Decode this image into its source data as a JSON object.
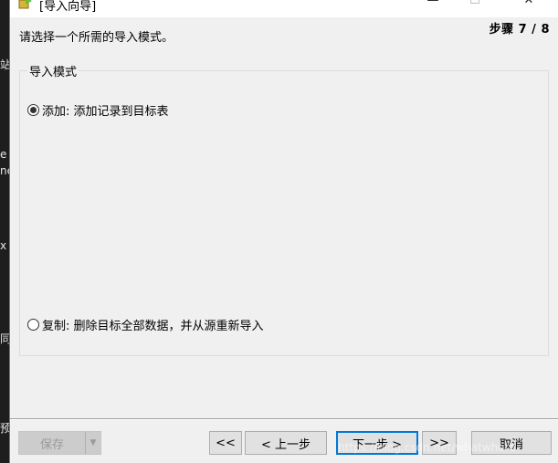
{
  "background": {
    "left_glyphs": [
      "站",
      "e",
      "ne",
      "x",
      "同",
      "预"
    ]
  },
  "window": {
    "title": "[导入向导]",
    "icon": "wizard-icon",
    "minimize": "—",
    "maximize": "☐",
    "close": "✕"
  },
  "wizard": {
    "step_label": "步骤 7 / 8",
    "prompt": "请选择一个所需的导入模式。",
    "group_title": "导入模式",
    "options": [
      {
        "label": "添加: 添加记录到目标表",
        "checked": true
      },
      {
        "label": "复制: 删除目标全部数据，并从源重新导入",
        "checked": false
      }
    ]
  },
  "footer": {
    "save_label": "保存",
    "save_dropdown_arrow": "▼",
    "first_label": "<<",
    "prev_label": "< 上一步",
    "next_label": "下一步 >",
    "last_label": ">>",
    "cancel_label": "取消"
  },
  "watermark": "https://blog.csdn.net/whatwhere"
}
